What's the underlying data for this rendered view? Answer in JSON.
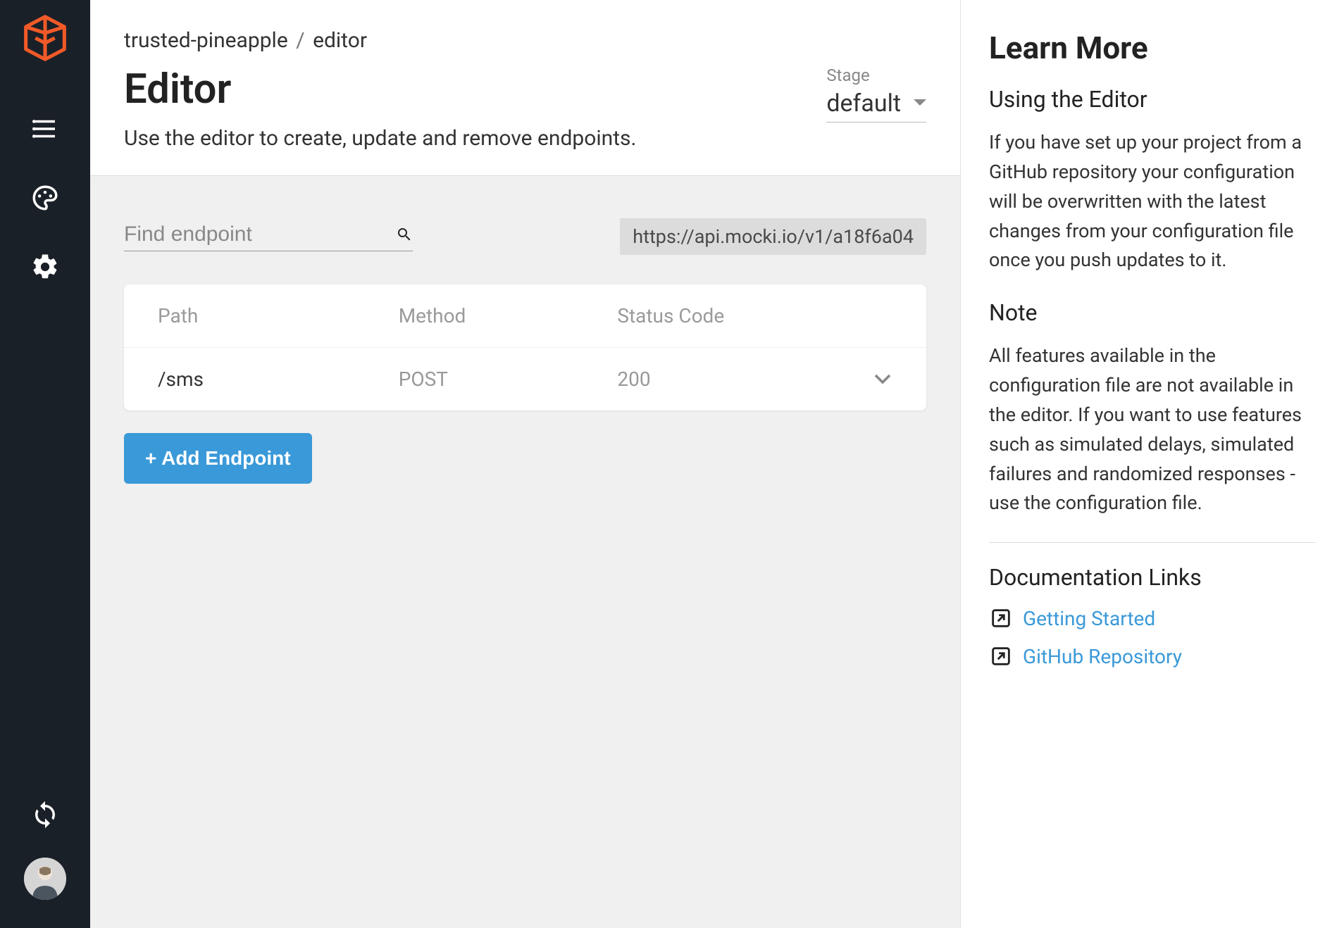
{
  "breadcrumb": {
    "project": "trusted-pineapple",
    "section": "editor",
    "sep": "/"
  },
  "page": {
    "title": "Editor",
    "subtitle": "Use the editor to create, update and remove endpoints."
  },
  "stage": {
    "label": "Stage",
    "value": "default"
  },
  "search": {
    "placeholder": "Find endpoint"
  },
  "api_url": "https://api.mocki.io/v1/a18f6a04",
  "table": {
    "headers": {
      "path": "Path",
      "method": "Method",
      "status": "Status Code"
    },
    "rows": [
      {
        "path": "/sms",
        "method": "POST",
        "status": "200"
      }
    ]
  },
  "add_button": "+ Add Endpoint",
  "learn_more": {
    "title": "Learn More",
    "using_title": "Using the Editor",
    "using_body": "If you have set up your project from a GitHub repository your configuration will be overwritten with the latest changes from your configuration file once you push updates to it.",
    "note_title": "Note",
    "note_body": "All features available in the configuration file are not available in the editor. If you want to use features such as simulated delays, simulated failures and randomized responses - use the configuration file.",
    "docs_title": "Documentation Links",
    "links": [
      {
        "label": "Getting Started"
      },
      {
        "label": "GitHub Repository"
      }
    ]
  }
}
